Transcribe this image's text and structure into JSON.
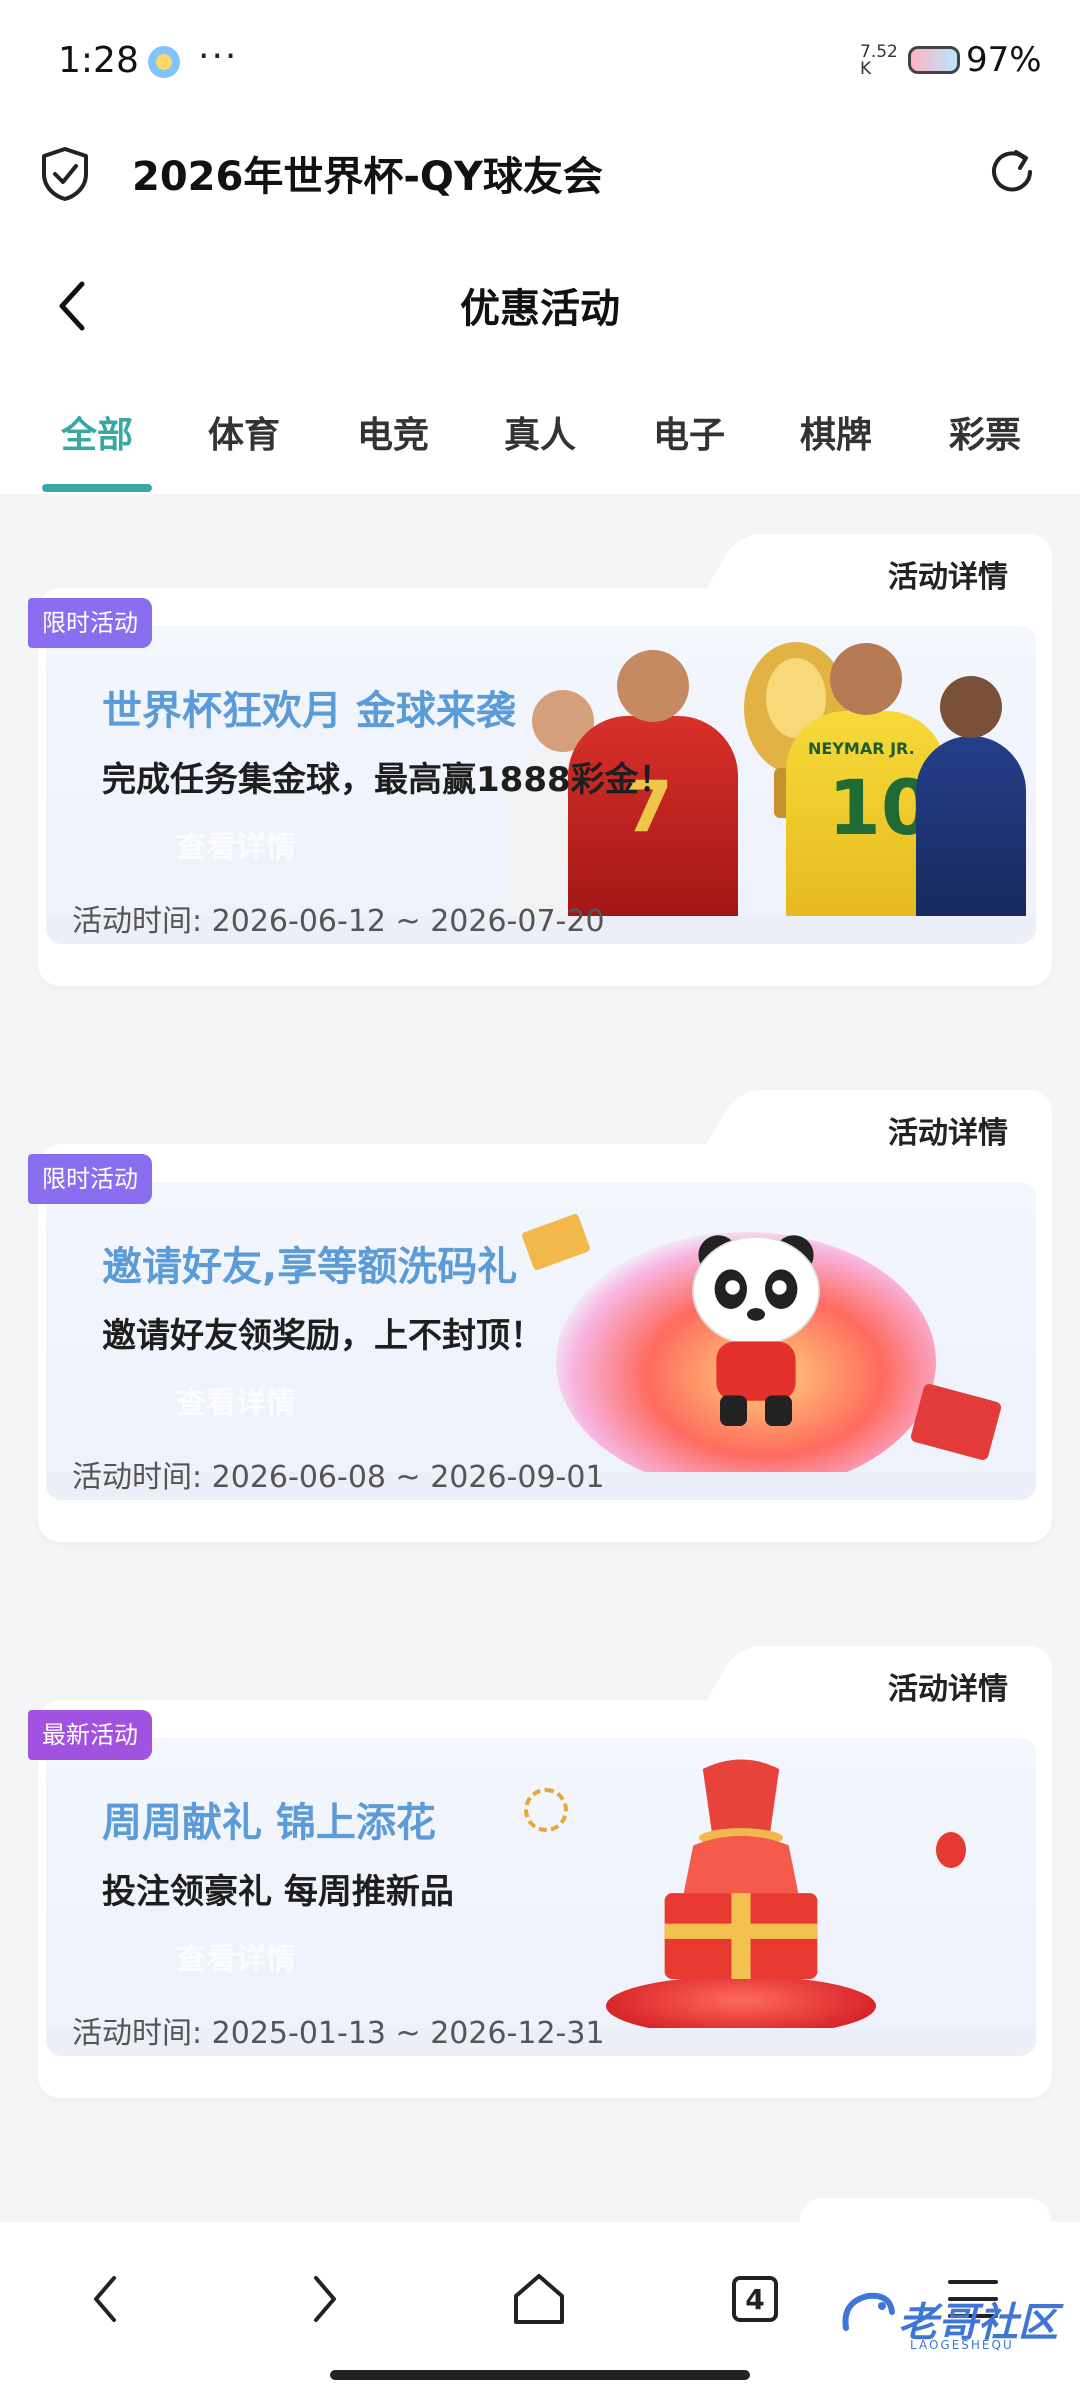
{
  "status_bar": {
    "time": "1:28",
    "dots": "···",
    "network_speed_value": "7.52",
    "network_speed_unit": "K",
    "battery": "97%"
  },
  "browser": {
    "title": "2026年世界杯-QY球友会"
  },
  "header": {
    "title": "优惠活动"
  },
  "tabs": [
    {
      "label": "全部",
      "active": true
    },
    {
      "label": "体育",
      "active": false
    },
    {
      "label": "电竞",
      "active": false
    },
    {
      "label": "真人",
      "active": false
    },
    {
      "label": "电子",
      "active": false
    },
    {
      "label": "棋牌",
      "active": false
    },
    {
      "label": "彩票",
      "active": false
    }
  ],
  "promotions": [
    {
      "badge": "限时活动",
      "detail_link": "活动详情",
      "title": "世界杯狂欢月 金球来袭",
      "subtitle": "完成任务集金球，最高赢1888彩金！",
      "ghost_button": "查看详情",
      "date": "活动时间: 2026-06-12 ~ 2026-07-20",
      "jersey_1": "7",
      "jersey_2": "10",
      "jersey_2_name": "NEYMAR JR."
    },
    {
      "badge": "限时活动",
      "detail_link": "活动详情",
      "title": "邀请好友,享等额洗码礼",
      "subtitle": "邀请好友领奖励，上不封顶！",
      "ghost_button": "查看详情",
      "date": "活动时间: 2026-06-08 ~ 2026-09-01"
    },
    {
      "badge": "最新活动",
      "detail_link": "活动详情",
      "title": "周周献礼 锦上添花",
      "subtitle": "投注领豪礼 每周推新品",
      "ghost_button": "查看详情",
      "date": "活动时间: 2025-01-13 ~ 2026-12-31"
    }
  ],
  "bottom_nav": {
    "tab_count": "4",
    "watermark": "老哥社区",
    "watermark_sub": "LAOGESHEQU"
  },
  "colors": {
    "accent": "#3aa7a7",
    "badge_limited": "#8b6ef0",
    "badge_new": "#a252e0",
    "title_blue": "#5b9bd8"
  }
}
